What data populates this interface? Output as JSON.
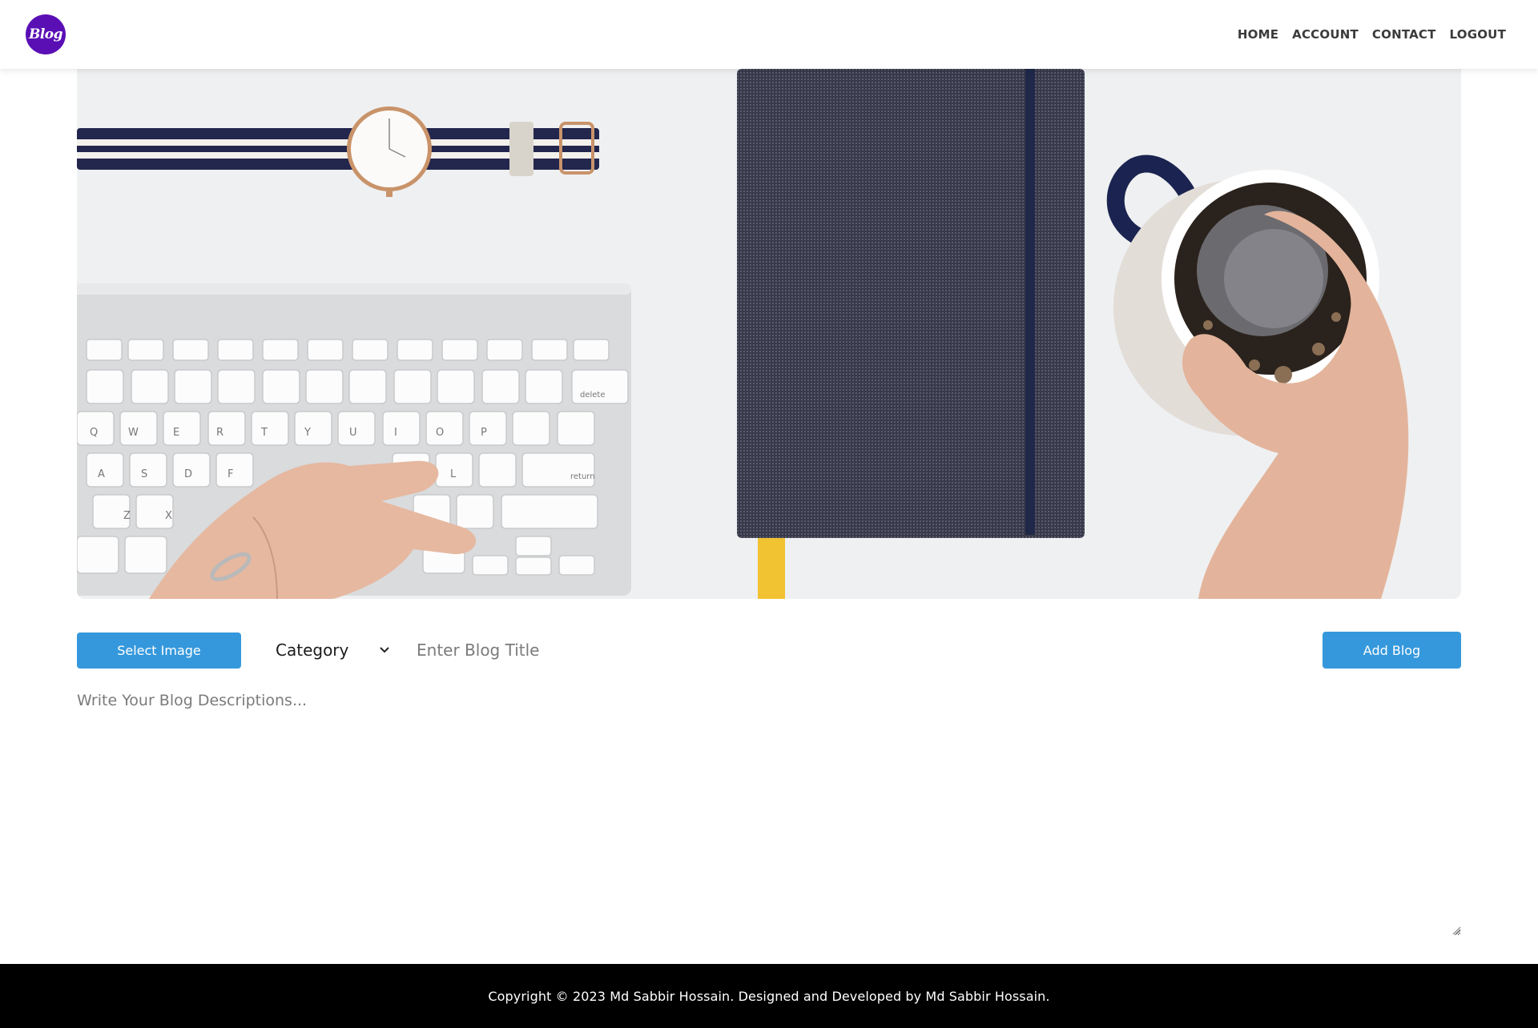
{
  "header": {
    "logo_text": "Blog",
    "nav": [
      "HOME",
      "ACCOUNT",
      "CONTACT",
      "LOGOUT"
    ]
  },
  "hero": {
    "image_description": "desk-flatlay-watch-keyboard-notebook-coffee"
  },
  "form": {
    "select_image_label": "Select Image",
    "category_value": "Category",
    "title_placeholder": "Enter Blog Title",
    "add_blog_label": "Add Blog",
    "description_placeholder": "Write Your Blog Descriptions..."
  },
  "footer": {
    "copyright": "Copyright © 2023 Md Sabbir Hossain. Designed and Developed by Md Sabbir Hossain."
  },
  "colors": {
    "primary_button": "#3598dc",
    "logo_bg": "#5a0fb5",
    "footer_bg": "#000000"
  }
}
